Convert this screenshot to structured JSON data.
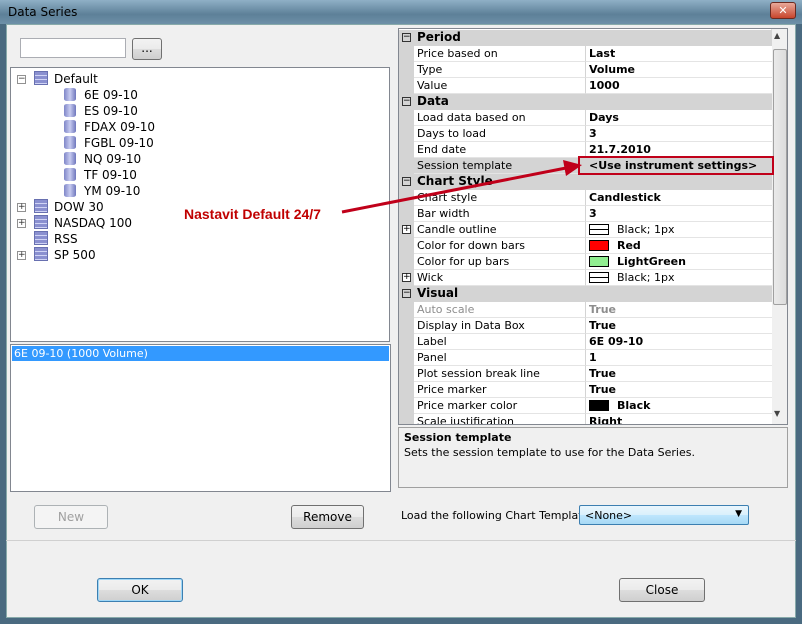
{
  "window": {
    "title": "Data Series",
    "close": "✕"
  },
  "search": {
    "value": "",
    "browse_label": "..."
  },
  "tree": [
    {
      "label": "Default",
      "expanded": true,
      "children": [
        "6E 09-10",
        "ES 09-10",
        "FDAX 09-10",
        "FGBL 09-10",
        "NQ 09-10",
        "TF 09-10",
        "YM 09-10"
      ]
    },
    {
      "label": "DOW 30",
      "expanded": false
    },
    {
      "label": "NASDAQ 100",
      "expanded": false
    },
    {
      "label": "RSS"
    },
    {
      "label": "SP 500",
      "expanded": false
    }
  ],
  "series_list": [
    "6E 09-10 (1000 Volume)"
  ],
  "buttons": {
    "new": "New",
    "remove": "Remove",
    "ok": "OK",
    "close": "Close"
  },
  "annotation": {
    "text": "Nastavit Default 24/7",
    "color": "#c00000"
  },
  "properties": [
    {
      "category": "Period",
      "items": [
        {
          "k": "Price based on",
          "v": "Last"
        },
        {
          "k": "Type",
          "v": "Volume"
        },
        {
          "k": "Value",
          "v": "1000"
        }
      ]
    },
    {
      "category": "Data",
      "items": [
        {
          "k": "Load data based on",
          "v": "Days"
        },
        {
          "k": "Days to load",
          "v": "3"
        },
        {
          "k": "End date",
          "v": "21.7.2010"
        },
        {
          "k": "Session template",
          "v": "<Use instrument settings>",
          "selected": true
        }
      ]
    },
    {
      "category": "Chart Style",
      "items": [
        {
          "k": "Chart style",
          "v": "Candlestick"
        },
        {
          "k": "Bar width",
          "v": "3"
        },
        {
          "k": "Candle outline",
          "v": "Black; 1px",
          "swatch": "line",
          "expandable": true
        },
        {
          "k": "Color for down bars",
          "v": "Red",
          "swatch": "#ff0000"
        },
        {
          "k": "Color for up bars",
          "v": "LightGreen",
          "swatch": "#90ee90"
        },
        {
          "k": "Wick",
          "v": "Black; 1px",
          "swatch": "line",
          "expandable": true
        }
      ]
    },
    {
      "category": "Visual",
      "items": [
        {
          "k": "Auto scale",
          "v": "True",
          "disabled": true
        },
        {
          "k": "Display in Data Box",
          "v": "True"
        },
        {
          "k": "Label",
          "v": "6E 09-10"
        },
        {
          "k": "Panel",
          "v": "1"
        },
        {
          "k": "Plot session break line",
          "v": "True"
        },
        {
          "k": "Price marker",
          "v": "True"
        },
        {
          "k": "Price marker color",
          "v": "Black",
          "swatch": "#000000"
        },
        {
          "k": "Scale justification",
          "v": "Right"
        }
      ]
    }
  ],
  "description": {
    "title": "Session template",
    "text": "Sets the session template to use for the Data Series."
  },
  "chart_template": {
    "label": "Load the following Chart Template:",
    "value": "<None>"
  }
}
